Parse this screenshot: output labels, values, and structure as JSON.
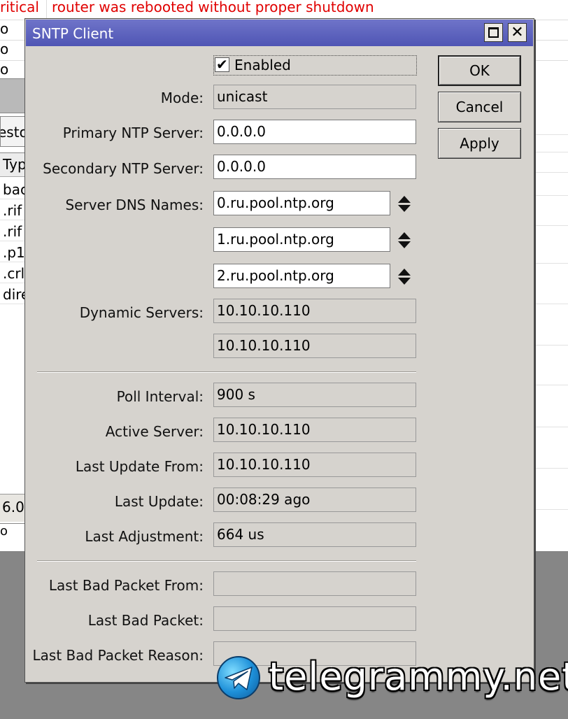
{
  "background": {
    "log_rows": [
      {
        "level": "ritical",
        "message": "router was rebooted without proper shutdown"
      },
      {
        "level": "o",
        "message": ""
      },
      {
        "level": "o",
        "message": ""
      },
      {
        "level": "o",
        "message": ""
      }
    ],
    "tab_label": "esto",
    "list_header": "Typ",
    "list_rows": [
      "bac",
      ".rif",
      ".rif",
      ".p1",
      ".crl",
      "dire"
    ],
    "status_value": "6.0",
    "mini_row": "o"
  },
  "dialog": {
    "title": "SNTP Client",
    "enabled": {
      "label": "Enabled",
      "checked": true,
      "check_glyph": "✔"
    },
    "fields": {
      "mode": {
        "label": "Mode:",
        "value": "unicast"
      },
      "primary_ntp": {
        "label": "Primary NTP Server:",
        "value": "0.0.0.0"
      },
      "secondary_ntp": {
        "label": "Secondary NTP Server:",
        "value": "0.0.0.0"
      },
      "server_dns_names": {
        "label": "Server DNS Names:",
        "values": [
          "0.ru.pool.ntp.org",
          "1.ru.pool.ntp.org",
          "2.ru.pool.ntp.org"
        ]
      },
      "dynamic_servers": {
        "label": "Dynamic Servers:",
        "values": [
          "10.10.10.110",
          "10.10.10.110"
        ]
      },
      "poll_interval": {
        "label": "Poll Interval:",
        "value": "900 s"
      },
      "active_server": {
        "label": "Active Server:",
        "value": "10.10.10.110"
      },
      "last_update_from": {
        "label": "Last Update From:",
        "value": "10.10.10.110"
      },
      "last_update": {
        "label": "Last Update:",
        "value": "00:08:29 ago"
      },
      "last_adjustment": {
        "label": "Last Adjustment:",
        "value": "664 us"
      },
      "last_bad_packet_from": {
        "label": "Last Bad Packet From:",
        "value": ""
      },
      "last_bad_packet": {
        "label": "Last Bad Packet:",
        "value": ""
      },
      "last_bad_packet_reason": {
        "label": "Last Bad Packet Reason:",
        "value": ""
      }
    },
    "buttons": {
      "ok": "OK",
      "cancel": "Cancel",
      "apply": "Apply"
    }
  },
  "watermark": {
    "text": "telegrammy.net",
    "icon": "telegram-logo-icon"
  },
  "colors": {
    "titlebar": "#5a5fbd",
    "dialog_bg": "#d6d3ce",
    "critical": "#e00000",
    "desktop": "#868686"
  }
}
